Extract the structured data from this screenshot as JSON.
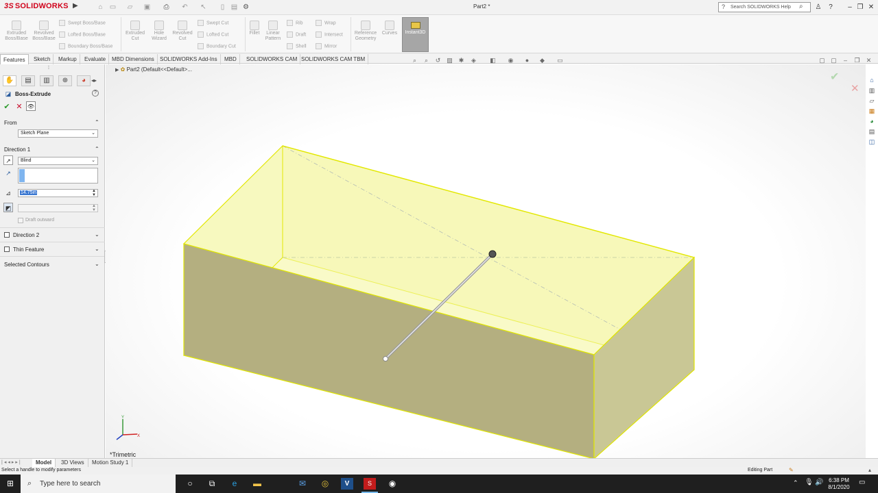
{
  "app": {
    "brand": "SOLIDWORKS",
    "doc_title": "Part2 *",
    "search_placeholder": "Search SOLIDWORKS Help"
  },
  "ribbon": {
    "extruded_boss": "Extruded Boss/Base",
    "revolved_boss": "Revolved Boss/Base",
    "swept_boss": "Swept Boss/Base",
    "lofted_boss": "Lofted Boss/Base",
    "boundary_boss": "Boundary Boss/Base",
    "extruded_cut": "Extruded Cut",
    "hole_wizard": "Hole Wizard",
    "revolved_cut": "Revolved Cut",
    "swept_cut": "Swept Cut",
    "lofted_cut": "Lofted Cut",
    "boundary_cut": "Boundary Cut",
    "fillet": "Fillet",
    "linear_pattern": "Linear Pattern",
    "rib": "Rib",
    "draft": "Draft",
    "shell": "Shell",
    "wrap": "Wrap",
    "intersect": "Intersect",
    "mirror": "Mirror",
    "reference_geometry": "Reference Geometry",
    "curves": "Curves",
    "instant3d": "Instant3D"
  },
  "tabs": [
    "Features",
    "Sketch",
    "Markup",
    "Evaluate",
    "MBD Dimensions",
    "SOLIDWORKS Add-Ins",
    "MBD",
    "SOLIDWORKS CAM",
    "SOLIDWORKS CAM TBM"
  ],
  "panel": {
    "title": "Boss-Extrude",
    "from_label": "From",
    "from_value": "Sketch Plane",
    "direction1_label": "Direction 1",
    "end_condition": "Blind",
    "depth_value": "14.75in",
    "draft_outward": "Draft outward",
    "direction2_label": "Direction 2",
    "thin_feature_label": "Thin Feature",
    "selected_contours_label": "Selected Contours"
  },
  "tree": {
    "part_label": "Part2  (Default<<Default>..."
  },
  "viewport": {
    "view_label": "*Trimetric"
  },
  "bottom_tabs": [
    "Model",
    "3D Views",
    "Motion Study 1"
  ],
  "status": {
    "hint": "Select a handle to modify parameters",
    "mode": "Editing Part"
  },
  "taskbar": {
    "search_placeholder": "Type here to search",
    "time": "6:38 PM",
    "date": "8/1/2020"
  },
  "colors": {
    "brand_red": "#d0021b",
    "preview_yellow": "#f4f59a",
    "preview_edge": "#e3e800",
    "taskbar": "#1f1f1f"
  }
}
